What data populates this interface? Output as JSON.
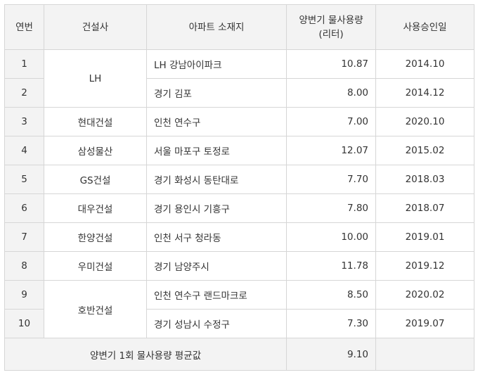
{
  "headers": {
    "no": "연번",
    "builder": "건설사",
    "location": "아파트 소재지",
    "volume_line1": "양변기 물사용량",
    "volume_line2": "(리터)",
    "approval": "사용승인일"
  },
  "rows": [
    {
      "no": "1",
      "builder": "LH",
      "location": "LH 강남아이파크",
      "volume": "10.87",
      "approval": "2014.10"
    },
    {
      "no": "2",
      "builder": "LH",
      "location": "경기 김포",
      "volume": "8.00",
      "approval": "2014.12"
    },
    {
      "no": "3",
      "builder": "현대건설",
      "location": "인천 연수구",
      "volume": "7.00",
      "approval": "2020.10"
    },
    {
      "no": "4",
      "builder": "삼성물산",
      "location": "서울 마포구 토정로",
      "volume": "12.07",
      "approval": "2015.02"
    },
    {
      "no": "5",
      "builder": "GS건설",
      "location": "경기 화성시 동탄대로",
      "volume": "7.70",
      "approval": "2018.03"
    },
    {
      "no": "6",
      "builder": "대우건설",
      "location": "경기 용인시 기흥구",
      "volume": "7.80",
      "approval": "2018.07"
    },
    {
      "no": "7",
      "builder": "한양건설",
      "location": "인천 서구 청라동",
      "volume": "10.00",
      "approval": "2019.01"
    },
    {
      "no": "8",
      "builder": "우미건설",
      "location": "경기 남양주시",
      "volume": "11.78",
      "approval": "2019.12"
    },
    {
      "no": "9",
      "builder": "호반건설",
      "location": "인천 연수구 랜드마크로",
      "volume": "8.50",
      "approval": "2020.02"
    },
    {
      "no": "10",
      "builder": "호반건설",
      "location": "경기 성남시 수정구",
      "volume": "7.30",
      "approval": "2019.07"
    }
  ],
  "footer": {
    "label": "양변기 1회 물사용량 평균값",
    "value": "9.10",
    "extra": ""
  }
}
